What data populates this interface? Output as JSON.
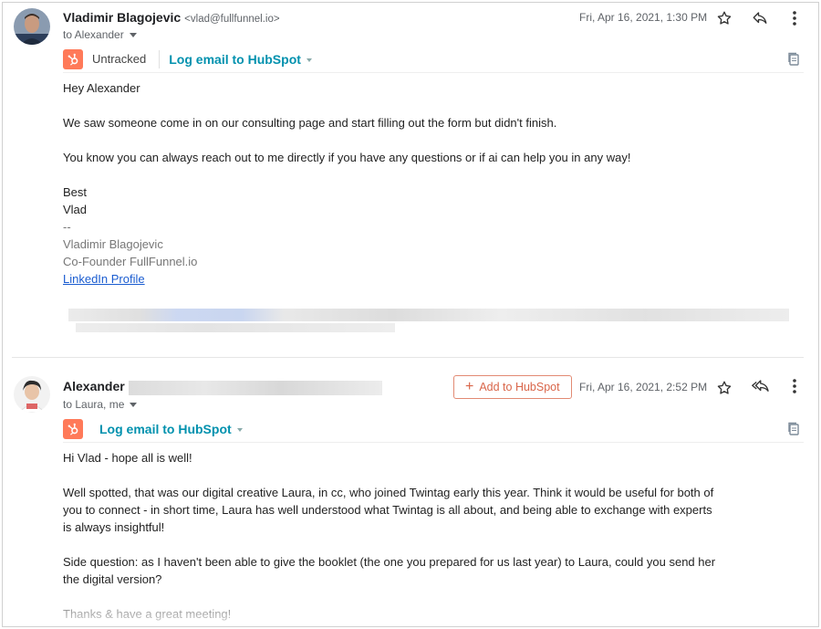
{
  "message1": {
    "sender_name": "Vladimir Blagojevic",
    "sender_email": "<vlad@fullfunnel.io>",
    "to_line": "to Alexander",
    "date": "Fri, Apr 16, 2021, 1:30 PM",
    "hubspot": {
      "status": "Untracked",
      "log_label": "Log email to HubSpot"
    },
    "greeting": "Hey Alexander",
    "paragraph1": "We saw someone come in on our consulting page and start filling out the form but didn't finish.",
    "paragraph2": "You know you can always reach out to me directly if you have any questions or if ai can help you in any way!",
    "closing": "Best",
    "closing_name": "Vlad",
    "sig_dash": "--",
    "sig_name": "Vladimir Blagojevic",
    "sig_title": "Co-Founder FullFunnel.io",
    "sig_link": "LinkedIn Profile"
  },
  "message2": {
    "sender_name": "Alexander",
    "to_line": "to Laura, me",
    "add_hubspot_label": "Add to HubSpot",
    "date": "Fri, Apr 16, 2021, 2:52 PM",
    "hubspot": {
      "log_label": "Log email to HubSpot"
    },
    "greeting": "Hi Vlad - hope all is well!",
    "paragraph1_line1": "Well spotted, that was our digital creative Laura, in cc, who joined Twintag early this year. Think it would be useful for both of",
    "paragraph1_line2": "you to connect - in short time, Laura has well understood what Twintag is all about, and being able to exchange with experts",
    "paragraph1_line3": "is always insightful!",
    "paragraph2_line1": "Side question: as I haven't been able to give the booklet (the one you prepared for us last year) to Laura, could you send her",
    "paragraph2_line2": "the digital version?",
    "closing": "Thanks & have a great meeting!"
  },
  "colors": {
    "hubspot_orange": "#ff7a59",
    "hubspot_teal": "#0091ae",
    "link_blue": "#1a5cd0"
  },
  "icons": [
    "star-icon",
    "reply-icon",
    "reply-all-icon",
    "more-vert-icon",
    "copy-icon",
    "hubspot-sprocket-icon"
  ]
}
